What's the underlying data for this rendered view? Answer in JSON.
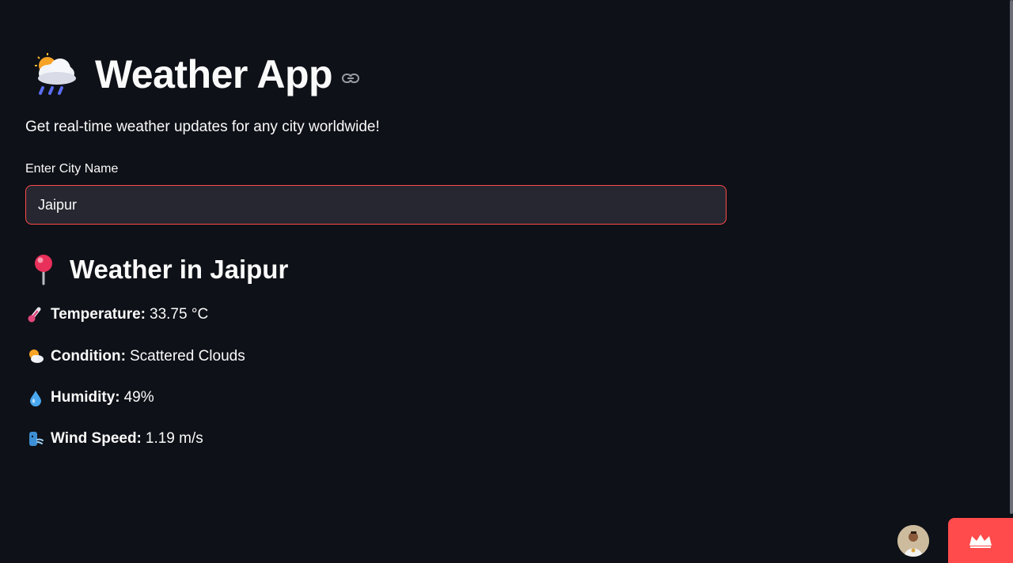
{
  "app": {
    "title": "Weather App",
    "subtitle": "Get real-time weather updates for any city worldwide!",
    "title_icon": "cloud-rain-sun-icon",
    "anchor_icon": "link-icon"
  },
  "search": {
    "label": "Enter City Name",
    "value": "Jaipur",
    "focus_color": "#ff4b4b"
  },
  "weather": {
    "heading": "Weather in Jaipur",
    "heading_icon": "pin-icon",
    "stats": [
      {
        "icon": "thermometer-icon",
        "label": "Temperature:",
        "value": "33.75 °C"
      },
      {
        "icon": "sun-behind-cloud-icon",
        "label": "Condition:",
        "value": "Scattered Clouds"
      },
      {
        "icon": "droplet-icon",
        "label": "Humidity:",
        "value": "49%"
      },
      {
        "icon": "wind-face-icon",
        "label": "Wind Speed:",
        "value": "1.19 m/s"
      }
    ]
  },
  "footer": {
    "avatar_icon": "user-avatar-icon",
    "badge_icon": "streamlit-crown-icon",
    "badge_color": "#ff4b4b"
  },
  "theme": {
    "background": "#0e1117",
    "input_background": "#262730",
    "text": "#fafafa"
  }
}
